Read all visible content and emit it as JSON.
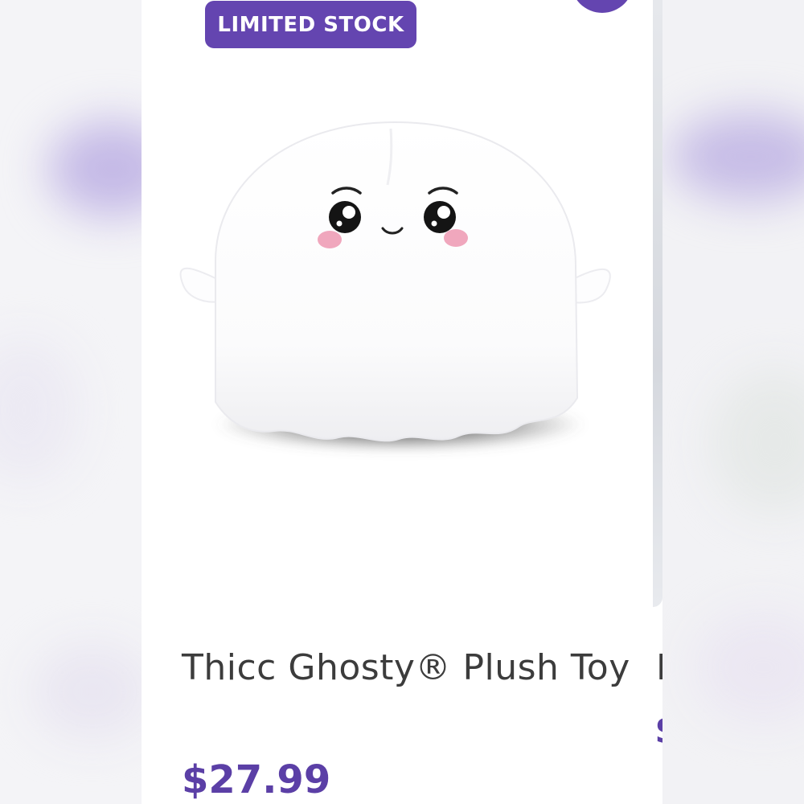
{
  "product": {
    "badge": "LIMITED STOCK",
    "title": "Thicc Ghosty® Plush Toy",
    "price": "$27.99",
    "image": "ghost-plush-photo"
  },
  "next_product": {
    "title_fragment": "E",
    "price_fragment": "$"
  },
  "colors": {
    "accent": "#6445b0",
    "price": "#5b3fa6",
    "title": "#3c3c3c",
    "background": "#ffffff"
  }
}
